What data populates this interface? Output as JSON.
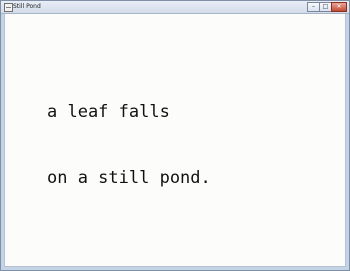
{
  "window": {
    "title": "Still Pond",
    "controls": {
      "minimize": "–",
      "maximize": "□",
      "close": "✕"
    }
  },
  "poem": {
    "lines": [
      "a leaf falls",
      "on a still pond."
    ]
  }
}
